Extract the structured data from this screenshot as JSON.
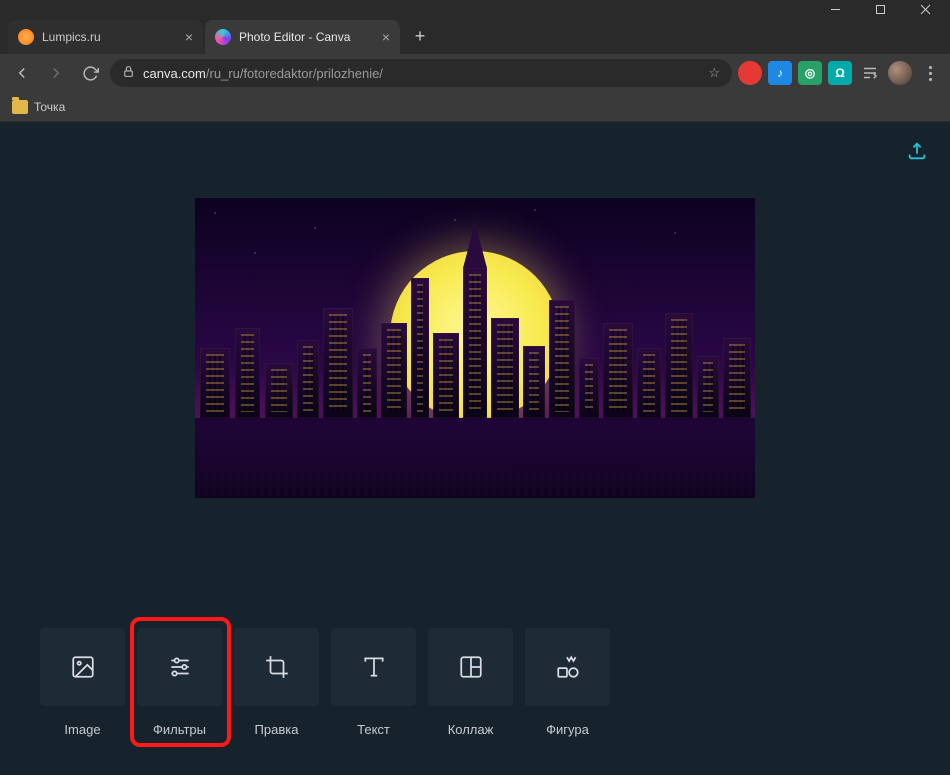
{
  "window": {
    "title": "Photo Editor - Canva"
  },
  "tabs": [
    {
      "label": "Lumpics.ru",
      "active": false
    },
    {
      "label": "Photo Editor - Canva",
      "active": true
    }
  ],
  "address": {
    "domain": "canva.com",
    "path": "/ru_ru/fotoredaktor/prilozhenie/"
  },
  "bookmarks": [
    {
      "label": "Точка"
    }
  ],
  "extensions": [
    {
      "name": "ext-red"
    },
    {
      "name": "ext-blue"
    },
    {
      "name": "ext-green"
    },
    {
      "name": "ext-teal"
    }
  ],
  "tools": [
    {
      "id": "image",
      "label": "Image",
      "icon": "image-icon"
    },
    {
      "id": "filters",
      "label": "Фильтры",
      "icon": "sliders-icon"
    },
    {
      "id": "crop",
      "label": "Правка",
      "icon": "crop-icon"
    },
    {
      "id": "text",
      "label": "Текст",
      "icon": "text-icon"
    },
    {
      "id": "collage",
      "label": "Коллаж",
      "icon": "collage-icon"
    },
    {
      "id": "shape",
      "label": "Фигура",
      "icon": "shapes-icon"
    }
  ],
  "highlighted_tool_index": 1
}
